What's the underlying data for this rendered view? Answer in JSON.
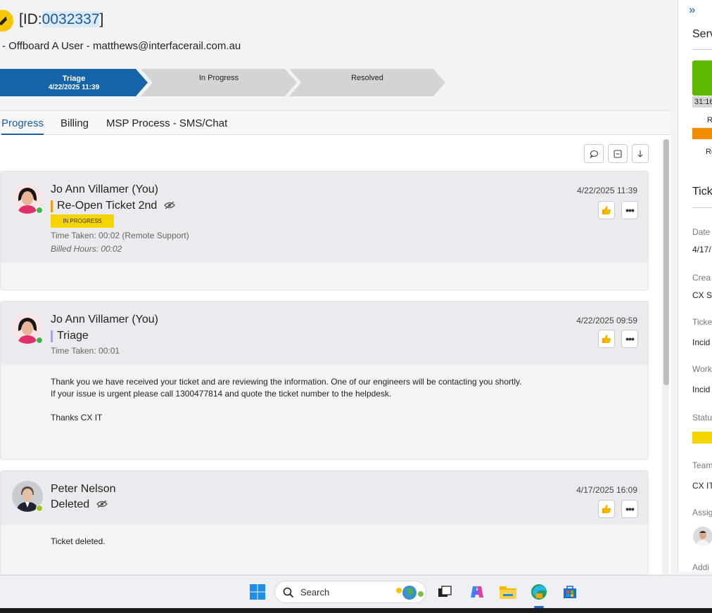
{
  "header": {
    "id_prefix": "[ID:",
    "id_number": "0032337",
    "id_suffix": "]",
    "subtitle": "- Offboard A User - matthews@interfacerail.com.au"
  },
  "stages": [
    {
      "label": "Triage",
      "date": "4/22/2025 11:39",
      "active": true
    },
    {
      "label": "In Progress",
      "active": false
    },
    {
      "label": "Resolved",
      "active": false
    }
  ],
  "tabs": [
    {
      "label": "Progress",
      "active": true
    },
    {
      "label": "Billing",
      "active": false
    },
    {
      "label": "MSP Process - SMS/Chat",
      "active": false
    }
  ],
  "entries": [
    {
      "author": "Jo Ann Villamer (You)",
      "timestamp": "4/22/2025 11:39",
      "status": "Re-Open Ticket 2nd",
      "status_color": "#f39c12",
      "badge": "IN PROGRESS",
      "time_taken": "Time Taken: 00:02 (Remote Support)",
      "billed": "Billed Hours: 00:02"
    },
    {
      "author": "Jo Ann Villamer (You)",
      "timestamp": "4/22/2025 09:59",
      "status": "Triage",
      "status_color": "#a8a0e8",
      "time_taken": "Time Taken: 00:01",
      "body": [
        "Thank you we have received your ticket and are reviewing the information. One of our engineers will be contacting you shortly.",
        "If your issue is urgent please call 1300477814 and quote the ticket number to the helpdesk.",
        "Thanks CX IT"
      ]
    },
    {
      "author": "Peter Nelson",
      "timestamp": "4/17/2025 16:09",
      "status": "Deleted",
      "body": [
        "Ticket deleted."
      ]
    }
  ],
  "sidebar": {
    "service_head": "Serv",
    "sla_time": "31:16",
    "sla_r1": "R",
    "sla_r2": "Re",
    "ticket_head": "Tick",
    "date_label": "Date",
    "date_value": "4/17/",
    "created_label": "Crea",
    "created_value": "CX S",
    "ticket_label": "Ticke",
    "ticket_value": "Incid",
    "work_label": "Work",
    "work_value": "Incid",
    "status_label": "Statu",
    "team_label": "Team",
    "team_value": "CX IT",
    "assignee_label": "Assig",
    "additional_label": "Addi"
  },
  "taskbar": {
    "search_placeholder": "Search"
  },
  "colors": {
    "primary": "#1565a8",
    "badge_yellow": "#f5d400",
    "sla_green": "#5cb800",
    "sla_orange": "#f08c00"
  }
}
